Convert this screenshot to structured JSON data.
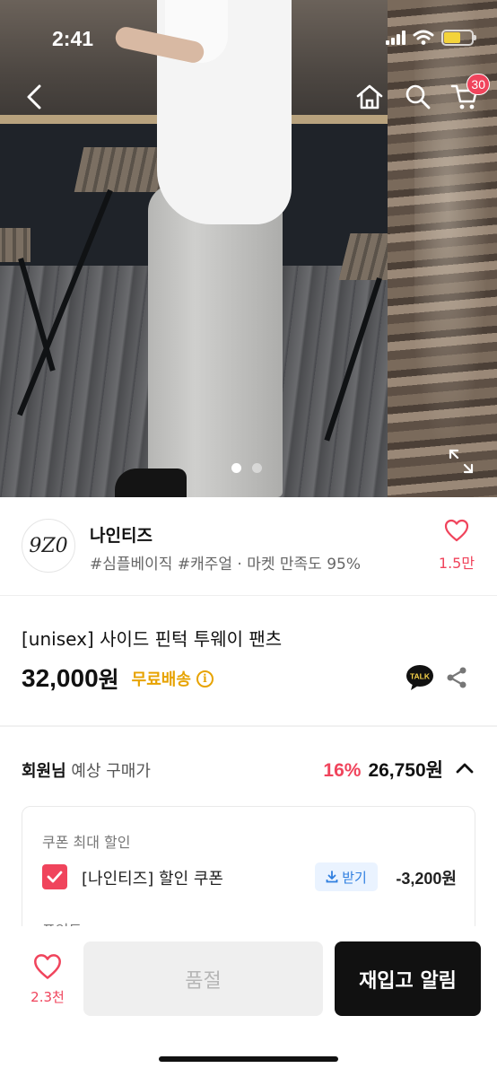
{
  "status_bar": {
    "time": "2:41"
  },
  "nav": {
    "cart_count": "30"
  },
  "gallery": {
    "slide_count": 2,
    "active_index": 0
  },
  "brand": {
    "logo_text": "9Z0",
    "name": "나인티즈",
    "tags": "#심플베이직 #캐주얼 · 마켓 만족도 95%",
    "like_count": "1.5만"
  },
  "product": {
    "title": "[unisex] 사이드 핀턱 투웨이 팬츠",
    "price": "32,000",
    "price_unit": "원",
    "shipping": "무료배송",
    "talk_label": "TALK"
  },
  "member_price": {
    "label_strong": "회원님",
    "label_rest": " 예상 구매가",
    "discount": "16%",
    "amount": "26,750원"
  },
  "coupon": {
    "section_title": "쿠폰 최대 할인",
    "name": "[나인티즈] 할인 쿠폰",
    "receive_label": "받기",
    "amount": "-3,200원",
    "next_section_title": "포인트"
  },
  "bottom_bar": {
    "like_count": "2.3천",
    "soldout_label": "품절",
    "restock_label": "재입고 알림"
  },
  "colors": {
    "accent": "#f0445c",
    "shipping": "#e7a300",
    "receive": "#2f7fe0",
    "primary_button": "#111111"
  }
}
